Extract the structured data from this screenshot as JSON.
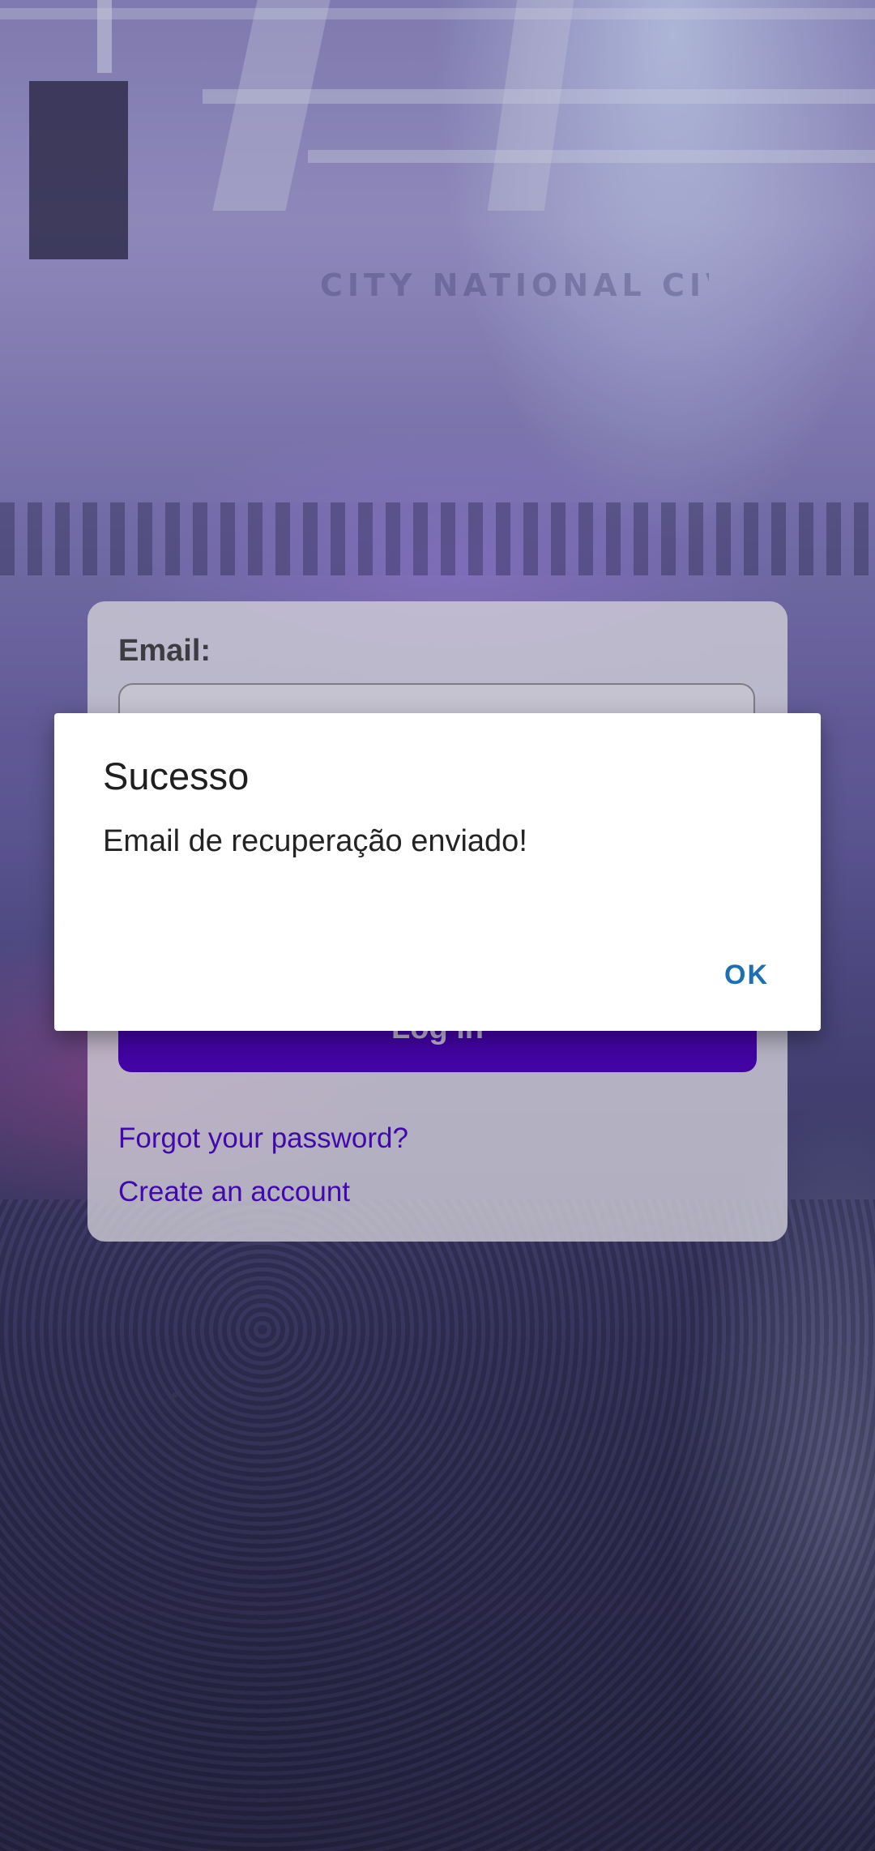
{
  "background": {
    "venue_sign_text": "CITY NATIONAL CIVIC"
  },
  "login_form": {
    "email_label": "Email:",
    "login_button_label": "Log in",
    "forgot_password_link": "Forgot your password?",
    "create_account_link": "Create an account",
    "accent_color": "#4a05b6"
  },
  "dialog": {
    "title": "Sucesso",
    "message": "Email de recuperação enviado!",
    "ok_button_label": "OK",
    "ok_color": "#1c70b2"
  }
}
